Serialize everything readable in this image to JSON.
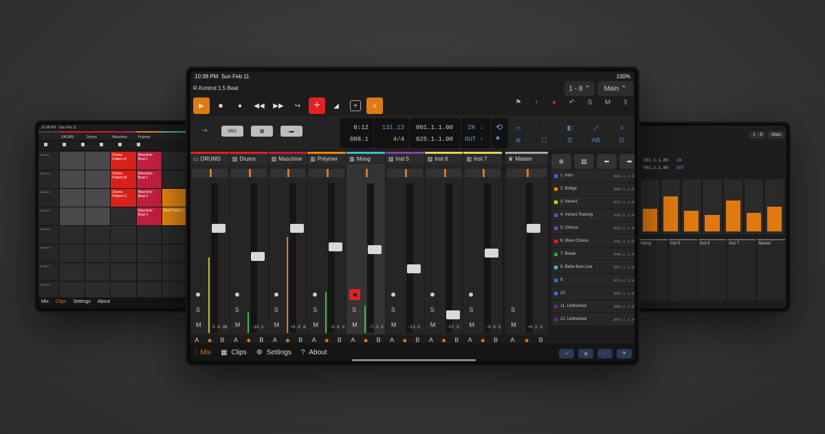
{
  "left_device": {
    "status": {
      "time": "10:38 PM",
      "date": "Sun Feb 11"
    },
    "tracks": [
      "DRUMS",
      "Drums",
      "Maschine",
      "Polymer"
    ],
    "scenes": [
      "Scene 1",
      "Scene 2",
      "Scene 3",
      "Scene 4",
      "Scene 5",
      "Scene 6",
      "Scene 7",
      "Scene 8"
    ],
    "clips": [
      {
        "row": 1,
        "col": 3,
        "label": "Drums Pattern A",
        "color": "#d8211a"
      },
      {
        "row": 1,
        "col": 4,
        "label": "Maschine Beat 1",
        "color": "#c0203d"
      },
      {
        "row": 2,
        "col": 3,
        "label": "Drums Pattern B",
        "color": "#d8211a"
      },
      {
        "row": 2,
        "col": 4,
        "label": "Maschine Beat 2",
        "color": "#c0203d"
      },
      {
        "row": 3,
        "col": 3,
        "label": "Drums Pattern C",
        "color": "#d8211a"
      },
      {
        "row": 3,
        "col": 4,
        "label": "Maschine Beat 3",
        "color": "#c0203d"
      },
      {
        "row": 3,
        "col": 5,
        "label": "",
        "color": "#e8870e"
      },
      {
        "row": 4,
        "col": 4,
        "label": "Maschine Beat 4",
        "color": "#c0203d"
      },
      {
        "row": 4,
        "col": 5,
        "label": "Main Pattern",
        "color": "#e8870e"
      }
    ],
    "nav": {
      "mix": "Mix",
      "clips": "Clips",
      "settings": "Settings",
      "about": "About"
    }
  },
  "right_device": {
    "pos1": "001.1.1.00",
    "pos2": "001.1.1.00",
    "in": "IN",
    "out": "OUT",
    "range": "1 - 8",
    "page": "Main",
    "fx": [
      0.55,
      0.85,
      0.5,
      0.4,
      0.75,
      0.45,
      0.6
    ],
    "channels": [
      "Moog",
      "Inst 5",
      "Inst 6",
      "Inst 7",
      "Master"
    ]
  },
  "main": {
    "status": {
      "time": "10:38 PM",
      "date": "Sun Feb 11",
      "battery": "100%"
    },
    "title": "R-Kontrol 1.5 Beat",
    "range_selector": "1 - 8 ⌃",
    "page_selector": "Main ⌃",
    "mix_button": "MIX",
    "transport": {
      "time": "0:12",
      "bars": "008.1",
      "tempo": "131.13",
      "signature": "4/4",
      "pos_in": "001.1.1.00",
      "pos_out": "025.1.1.00",
      "in_label": "IN",
      "out_label": "OUT"
    },
    "channels": [
      {
        "name": "DRUMS",
        "color": "#e02222",
        "icon": "folder-icon",
        "level": 0.75,
        "meter": 0.55,
        "db": "0.0 dB",
        "rec": false
      },
      {
        "name": "Drums",
        "color": "#e02222",
        "icon": "keyboard-icon",
        "level": 0.52,
        "meter": 0.15,
        "db": "-10.2 dB",
        "rec": false
      },
      {
        "name": "Maschine",
        "color": "#c0203d",
        "icon": "keyboard-icon",
        "level": 0.75,
        "meter": 0.7,
        "db": "+0.0 dB",
        "rec": false
      },
      {
        "name": "Polymer",
        "color": "#e8870e",
        "icon": "keyboard-icon",
        "level": 0.6,
        "meter": 0.3,
        "db": "-6.9 dB",
        "rec": false
      },
      {
        "name": "Moog",
        "color": "#3bbfcf",
        "icon": "keyboard-icon",
        "level": 0.58,
        "meter": 0.2,
        "db": "-7.3 dB",
        "rec": true
      },
      {
        "name": "Inst 5",
        "color": "#8a3fb0",
        "icon": "keyboard-icon",
        "level": 0.42,
        "meter": 0,
        "db": "-13.9 dB",
        "rec": false
      },
      {
        "name": "Inst 6",
        "color": "#e3d35a",
        "icon": "keyboard-icon",
        "level": 0.05,
        "meter": 0,
        "db": "-57.6 dB",
        "rec": false
      },
      {
        "name": "Inst 7",
        "color": "#e3d35a",
        "icon": "keyboard-icon",
        "level": 0.55,
        "meter": 0,
        "db": "-8.8 dB",
        "rec": false
      },
      {
        "name": "Master",
        "color": "#aaaaaa",
        "icon": "crown-icon",
        "level": 0.75,
        "meter": 0,
        "db": "+0.1 dB",
        "rec": false
      }
    ],
    "strip_labels": {
      "s": "S",
      "m": "M",
      "a": "A",
      "b": "B"
    },
    "markers": [
      {
        "label": "1. Intro",
        "pos": "001.1.1.00",
        "color": "#3b6fe0"
      },
      {
        "label": "2. Bridge",
        "pos": "009.1.1.00",
        "color": "#e8870e"
      },
      {
        "label": "3. Verse1",
        "pos": "017.1.1.00",
        "color": "#e3c820"
      },
      {
        "label": "4. Verse1 Raising",
        "pos": "025.1.1.00",
        "color": "#7b3fe0"
      },
      {
        "label": "5. Chorus",
        "pos": "033.1.1.00",
        "color": "#7b3fe0"
      },
      {
        "label": "6. More Chorus",
        "pos": "041.1.1.00",
        "color": "#e02222"
      },
      {
        "label": "7. Break",
        "pos": "049.1.1.00",
        "color": "#27a844"
      },
      {
        "label": "8. Betta than Live",
        "pos": "057.1.1.00",
        "color": "#3bbfcf"
      },
      {
        "label": "9.",
        "pos": "073.1.1.00",
        "color": "#3b6fe0"
      },
      {
        "label": "10.",
        "pos": "081.1.1.00",
        "color": "#3b6fe0"
      },
      {
        "label": "11. Unfinished",
        "pos": "089.1.1.00",
        "color": "#6a2b8a"
      },
      {
        "label": "12. Unfinished",
        "pos": "097.1.1.00",
        "color": "#6a2b8a"
      }
    ],
    "nav": {
      "mix": "Mix",
      "clips": "Clips",
      "settings": "Settings",
      "about": "About"
    },
    "top_right_icons": [
      "S",
      "M"
    ],
    "colors": {
      "accent": "#e07a10",
      "record": "#e02222",
      "blue": "#5c88c8"
    }
  }
}
